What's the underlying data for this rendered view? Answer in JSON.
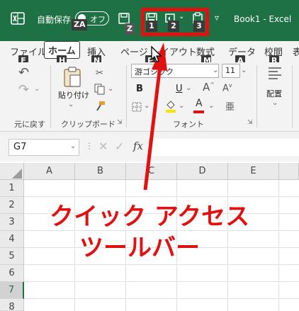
{
  "titlebar": {
    "autosave_label": "自動保存",
    "autosave_state": "オフ",
    "book_title": "Book1  -  Excel",
    "accent": "#1e7145"
  },
  "keytips": {
    "autosave": "ZA",
    "qa1": "1",
    "qa2": "2",
    "qa3": "3",
    "z": "Z",
    "file": "F",
    "home": "H",
    "insert": "N",
    "layout": "P",
    "formulas": "M",
    "data": "A",
    "review": "R"
  },
  "tabs": [
    "ファイル",
    "ホーム",
    "挿入",
    "ページ レイアウト",
    "数式",
    "データ",
    "校閲",
    "表"
  ],
  "ribbon": {
    "undo_group": "元に戻す",
    "clipboard_group": "クリップボード",
    "paste_label": "貼り付け",
    "font_group": "フォント",
    "font_name": "游ゴシック",
    "font_size": "11",
    "align_label": "配置",
    "bold": "B",
    "italic": "I",
    "underline": "U",
    "font_color_letter": "A"
  },
  "formula_bar": {
    "name_box": "G7",
    "fx": "fx"
  },
  "grid": {
    "columns": [
      "A",
      "B",
      "C",
      "D",
      "E"
    ],
    "rows": [
      "1",
      "2",
      "3",
      "4",
      "5",
      "6",
      "7",
      "8"
    ],
    "selected_row": "7"
  },
  "annotation": {
    "line1": "クイック アクセス",
    "line2": "ツールバー",
    "color": "#e01111"
  }
}
